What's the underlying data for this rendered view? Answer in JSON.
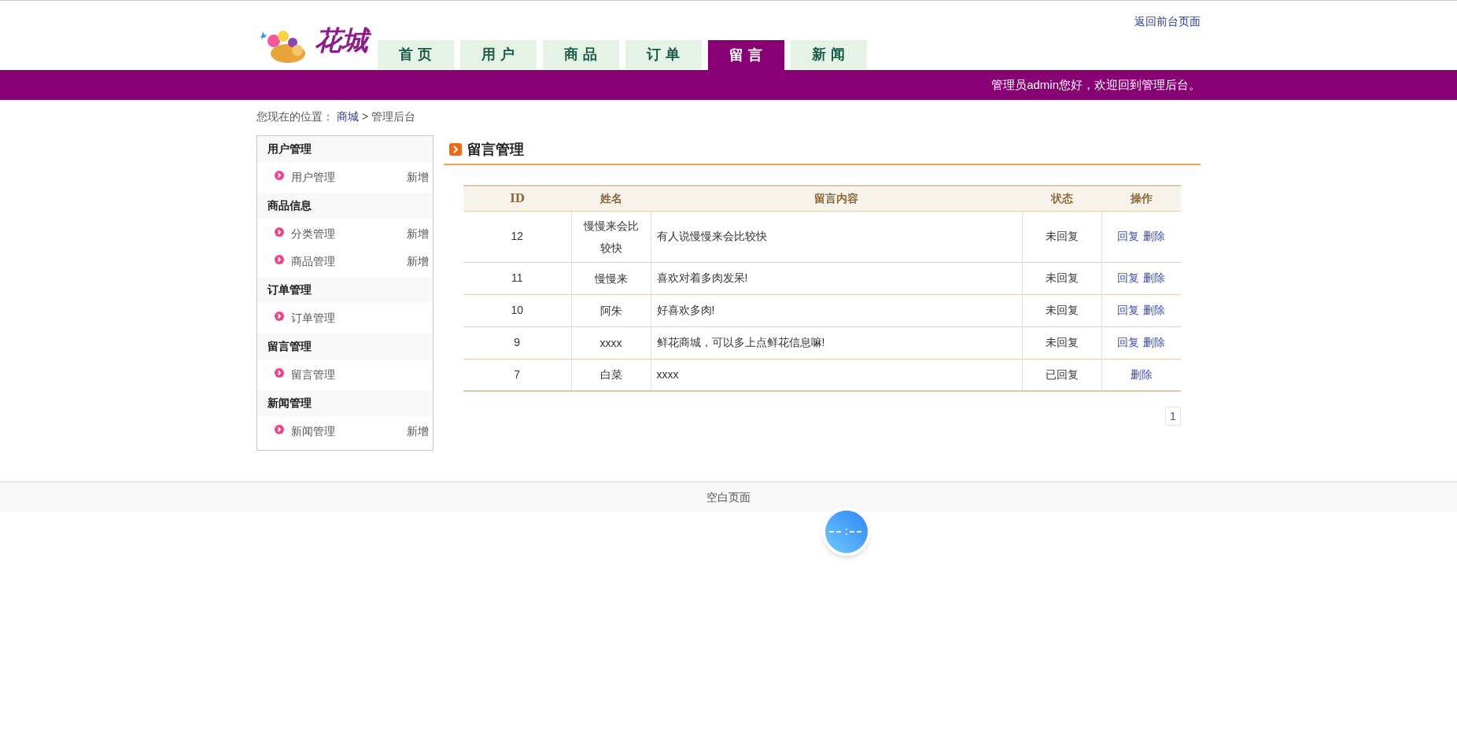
{
  "header": {
    "logo_text": "花城",
    "back_link": "返回前台页面"
  },
  "nav_tabs": [
    {
      "label": "首 页",
      "selected": false
    },
    {
      "label": "用 户",
      "selected": false
    },
    {
      "label": "商 品",
      "selected": false
    },
    {
      "label": "订 单",
      "selected": false
    },
    {
      "label": "留 言",
      "selected": true
    },
    {
      "label": "新 闻",
      "selected": false
    }
  ],
  "welcome": "管理员admin您好，欢迎回到管理后台。",
  "breadcrumb": {
    "prefix": "您现在的位置：",
    "link": "商城",
    "separator": ">",
    "current": "管理后台"
  },
  "sidebar": [
    {
      "title": "用户管理",
      "items": [
        {
          "label": "用户管理",
          "action": "新增"
        }
      ]
    },
    {
      "title": "商品信息",
      "items": [
        {
          "label": "分类管理",
          "action": "新增"
        },
        {
          "label": "商品管理",
          "action": "新增"
        }
      ]
    },
    {
      "title": "订单管理",
      "items": [
        {
          "label": "订单管理"
        }
      ]
    },
    {
      "title": "留言管理",
      "items": [
        {
          "label": "留言管理"
        }
      ]
    },
    {
      "title": "新闻管理",
      "items": [
        {
          "label": "新闻管理",
          "action": "新增"
        }
      ]
    }
  ],
  "panel_title": "留言管理",
  "table": {
    "columns": [
      "ID",
      "姓名",
      "留言内容",
      "状态",
      "操作"
    ],
    "rows": [
      {
        "id": "12",
        "name": "慢慢来会比较快",
        "content": "有人说慢慢来会比较快",
        "status": "未回复",
        "actions": [
          "回复",
          "删除"
        ]
      },
      {
        "id": "11",
        "name": "慢慢来",
        "content": "喜欢对着多肉发呆!",
        "status": "未回复",
        "actions": [
          "回复",
          "删除"
        ]
      },
      {
        "id": "10",
        "name": "阿朱",
        "content": "好喜欢多肉!",
        "status": "未回复",
        "actions": [
          "回复",
          "删除"
        ]
      },
      {
        "id": "9",
        "name": "xxxx",
        "content": "鲜花商城，可以多上点鲜花信息嘛!",
        "status": "未回复",
        "actions": [
          "回复",
          "删除"
        ]
      },
      {
        "id": "7",
        "name": "白菜",
        "content": "xxxx",
        "status": "已回复",
        "actions": [
          "删除"
        ]
      }
    ]
  },
  "pagination": [
    {
      "label": "1",
      "selected": true
    }
  ],
  "footer": "空白页面"
}
